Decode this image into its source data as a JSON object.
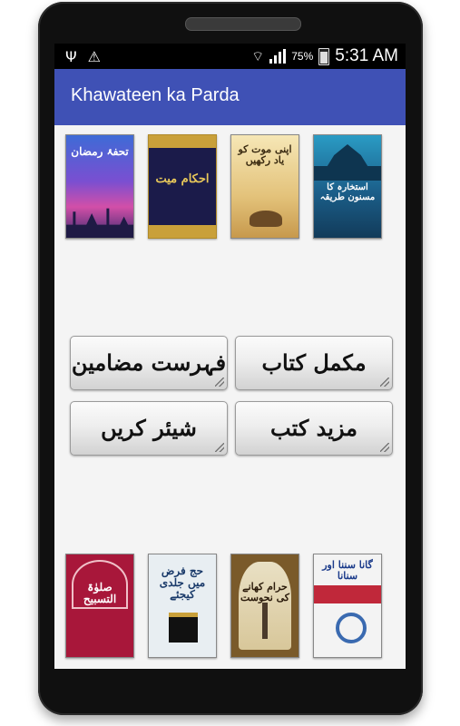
{
  "status_bar": {
    "battery_pct": "75%",
    "time": "5:31 AM",
    "icons": [
      "usb-icon",
      "warning-icon",
      "wifi-icon",
      "signal-icon",
      "battery-icon"
    ]
  },
  "app_bar": {
    "title": "Khawateen ka Parda"
  },
  "colors": {
    "app_bar": "#3f51b5",
    "status_bar": "#000000",
    "background": "#f4f4f4"
  },
  "books_top": [
    {
      "title": "تحفۂ رمضان"
    },
    {
      "title": "احکام میت"
    },
    {
      "title": "اپنی موت کو یاد رکھیں"
    },
    {
      "title": "استخارہ کا مسنون طریقہ"
    }
  ],
  "buttons": {
    "index": "فہرست مضامین",
    "full_book": "مکمل کتاب",
    "share": "شیئر کریں",
    "more_books": "مزید کتب"
  },
  "books_bottom": [
    {
      "title": "صلوٰۃ التسبیح"
    },
    {
      "title": "حج فرض میں جلدی کیجئے"
    },
    {
      "title": "حرام کھانے کی نحوست"
    },
    {
      "title": "گانا سننا اور سنانا"
    }
  ]
}
